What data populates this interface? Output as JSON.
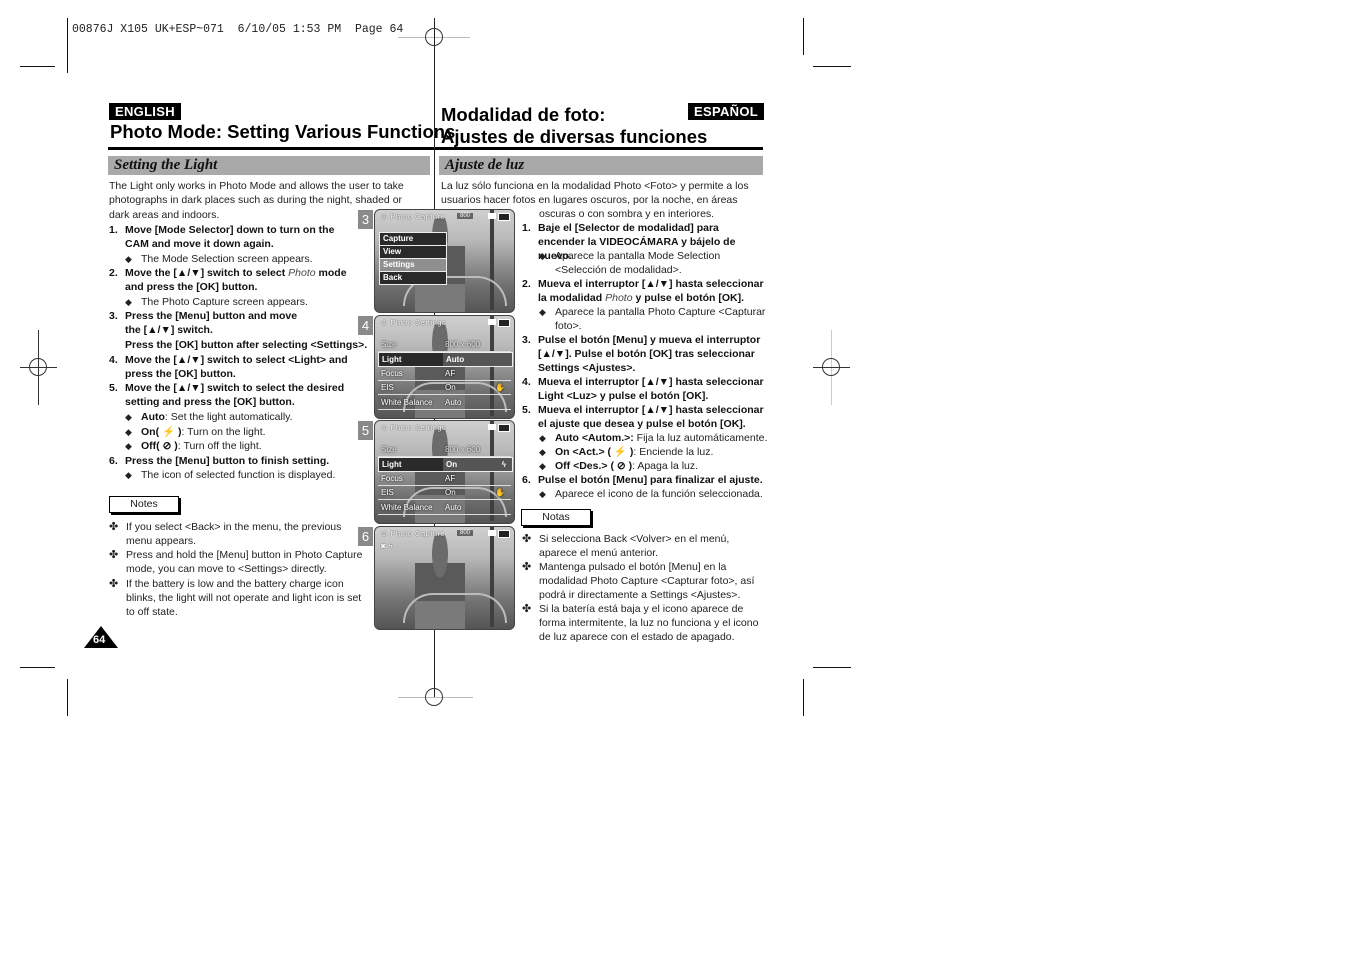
{
  "print_header": "00876J X105 UK+ESP~071  6/10/05 1:53 PM  Page 64",
  "page_number": "64",
  "english": {
    "lang_badge": "ENGLISH",
    "title": "Photo Mode: Setting Various Functions",
    "section": "Setting the Light",
    "intro": "The Light only works in Photo Mode and allows the user to take photographs in dark places such as during the night, shaded or dark areas and indoors.",
    "steps": [
      {
        "num": "1.",
        "text": "Move [Mode Selector] down to turn on the CAM and move it down again.",
        "subs": [
          "The Mode Selection screen appears."
        ]
      },
      {
        "num": "2.",
        "text_before": "Move the [▲/▼] switch to select ",
        "text_italic": "Photo",
        "text_after": " mode and press the [OK] button.",
        "subs": [
          "The Photo Capture screen appears."
        ]
      },
      {
        "num": "3.",
        "text": "Press the [Menu] button and move the [▲/▼] switch.",
        "text2": "Press the [OK] button after selecting <Settings>."
      },
      {
        "num": "4.",
        "text": "Move the [▲/▼] switch to select <Light> and press the [OK] button."
      },
      {
        "num": "5.",
        "text": "Move the [▲/▼] switch to select the desired setting and press the [OK] button.",
        "options": [
          {
            "label": "Auto",
            "desc": ": Set the light automatically."
          },
          {
            "label": "On( ⚡ )",
            "desc": ": Turn on the light."
          },
          {
            "label": "Off( ⊘ )",
            "desc": ": Turn off the light."
          }
        ]
      },
      {
        "num": "6.",
        "text": "Press the [Menu] button to finish setting.",
        "subs": [
          "The icon of selected function is displayed."
        ]
      }
    ],
    "notes_label": "Notes",
    "notes": [
      "If you select <Back> in the menu, the previous menu appears.",
      "Press and hold the [Menu] button in Photo Capture mode, you can move to <Settings> directly.",
      "If the battery is low and the battery charge icon blinks, the light will not operate and light icon is set to off state."
    ]
  },
  "spanish": {
    "lang_badge": "ESPAÑOL",
    "title_line1": "Modalidad de foto:",
    "title_line2": "Ajustes de diversas funciones",
    "section": "Ajuste de luz",
    "intro1": "La luz sólo funciona en la modalidad Photo <Foto> y permite a los usuarios hacer fotos en lugares oscuros, por la noche, en áreas",
    "intro2": "oscuras o con sombra y en interiores.",
    "steps": [
      {
        "num": "1.",
        "text": "Baje el [Selector de modalidad] para encender la VIDEOCÁMARA y bájelo de nuevo.",
        "subs": [
          "Aparece la pantalla Mode Selection <Selección de modalidad>."
        ]
      },
      {
        "num": "2.",
        "text_before": "Mueva el interruptor [▲/▼] hasta seleccionar la modalidad ",
        "text_italic": "Photo",
        "text_after": " y pulse el botón [OK].",
        "subs": [
          "Aparece la pantalla Photo Capture <Capturar foto>."
        ]
      },
      {
        "num": "3.",
        "text": "Pulse el botón [Menu] y mueva el interruptor [▲/▼]. Pulse el botón [OK] tras seleccionar Settings <Ajustes>."
      },
      {
        "num": "4.",
        "text": "Mueva el interruptor [▲/▼] hasta seleccionar Light <Luz> y pulse el botón [OK]."
      },
      {
        "num": "5.",
        "text": "Mueva el interruptor [▲/▼] hasta seleccionar el ajuste que desea y pulse el botón [OK].",
        "options": [
          {
            "label": "Auto <Autom.>:",
            "desc": " Fija la luz automáticamente."
          },
          {
            "label": "On <Act.> ( ⚡ )",
            "desc": ": Enciende la luz."
          },
          {
            "label": "Off <Des.> ( ⊘ )",
            "desc": ": Apaga la luz."
          }
        ]
      },
      {
        "num": "6.",
        "text": "Pulse el botón [Menu] para finalizar el ajuste.",
        "subs": [
          "Aparece el icono de la función seleccionada."
        ]
      }
    ],
    "notes_label": "Notas",
    "notes": [
      "Si selecciona Back <Volver> en el menú, aparece el menú anterior.",
      "Mantenga pulsado el botón [Menu] en la modalidad Photo Capture <Capturar foto>, así podrá ir directamente a Settings <Ajustes>.",
      "Si la batería está baja y el icono aparece de forma intermitente, la luz no funciona y el icono de luz aparece con el estado de apagado."
    ]
  },
  "screens": [
    {
      "num": "3",
      "title": "Photo Capture",
      "badge": "800",
      "menu": [
        {
          "label": "Capture"
        },
        {
          "label": "View"
        },
        {
          "label": "Settings",
          "selected": true
        },
        {
          "label": "Back"
        }
      ]
    },
    {
      "num": "4",
      "title": "Photo Settings",
      "rows": [
        {
          "key": "Size",
          "value": "800 x 600"
        },
        {
          "key": "Light",
          "value": "Auto",
          "selected": true
        },
        {
          "key": "Focus",
          "value": "AF"
        },
        {
          "key": "EIS",
          "value": "On"
        },
        {
          "key": "White Balance",
          "value": "Auto"
        }
      ]
    },
    {
      "num": "5",
      "title": "Photo Settings",
      "rows": [
        {
          "key": "Size",
          "value": "800 x 600"
        },
        {
          "key": "Light",
          "value": "On",
          "icon": "ϟ",
          "selected": true
        },
        {
          "key": "Focus",
          "value": "AF"
        },
        {
          "key": "EIS",
          "value": "On"
        },
        {
          "key": "White Balance",
          "value": "Auto"
        }
      ]
    },
    {
      "num": "6",
      "title": "Photo Capture",
      "badge": "800",
      "status_icons": "◙ ϟ"
    }
  ]
}
